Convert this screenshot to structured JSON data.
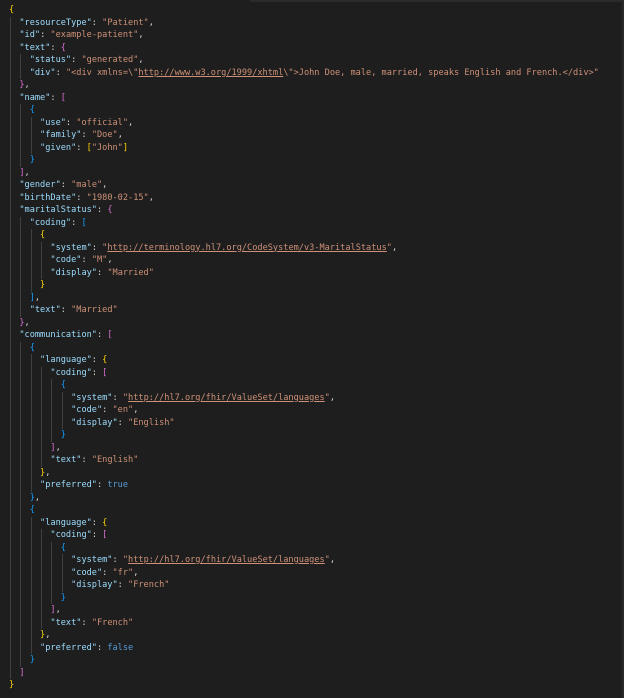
{
  "editor": {
    "language": "json",
    "theme_colors": {
      "background": "#1e1e1e",
      "key": "#9cdcfe",
      "string": "#ce9178",
      "keyword": "#569cd6",
      "punctuation": "#d4d4d4",
      "bracket_level_1": "#ffd700",
      "bracket_level_2": "#da70d6",
      "bracket_level_3": "#179fff"
    },
    "lines": [
      [
        [
          "{",
          "b0"
        ]
      ],
      [
        [
          "  ",
          ""
        ],
        [
          "\"resourceType\"",
          "k"
        ],
        [
          ": ",
          "p"
        ],
        [
          "\"Patient\"",
          "s"
        ],
        [
          ",",
          "p"
        ]
      ],
      [
        [
          "  ",
          ""
        ],
        [
          "\"id\"",
          "k"
        ],
        [
          ": ",
          "p"
        ],
        [
          "\"example-patient\"",
          "s"
        ],
        [
          ",",
          "p"
        ]
      ],
      [
        [
          "  ",
          ""
        ],
        [
          "\"text\"",
          "k"
        ],
        [
          ": ",
          "p"
        ],
        [
          "{",
          "b1"
        ]
      ],
      [
        [
          "    ",
          ""
        ],
        [
          "\"status\"",
          "k"
        ],
        [
          ": ",
          "p"
        ],
        [
          "\"generated\"",
          "s"
        ],
        [
          ",",
          "p"
        ]
      ],
      [
        [
          "    ",
          ""
        ],
        [
          "\"div\"",
          "k"
        ],
        [
          ": ",
          "p"
        ],
        [
          "\"<div xmlns=\\\"",
          "s"
        ],
        [
          "http://www.w3.org/1999/xhtml",
          "su"
        ],
        [
          "\\\">John Doe, male, married, speaks English and French.</div>\"",
          "s"
        ]
      ],
      [
        [
          "  ",
          ""
        ],
        [
          "}",
          "b1"
        ],
        [
          ",",
          "p"
        ]
      ],
      [
        [
          "  ",
          ""
        ],
        [
          "\"name\"",
          "k"
        ],
        [
          ": ",
          "p"
        ],
        [
          "[",
          "b1"
        ]
      ],
      [
        [
          "    ",
          ""
        ],
        [
          "{",
          "b2"
        ]
      ],
      [
        [
          "      ",
          ""
        ],
        [
          "\"use\"",
          "k"
        ],
        [
          ": ",
          "p"
        ],
        [
          "\"official\"",
          "s"
        ],
        [
          ",",
          "p"
        ]
      ],
      [
        [
          "      ",
          ""
        ],
        [
          "\"family\"",
          "k"
        ],
        [
          ": ",
          "p"
        ],
        [
          "\"Doe\"",
          "s"
        ],
        [
          ",",
          "p"
        ]
      ],
      [
        [
          "      ",
          ""
        ],
        [
          "\"given\"",
          "k"
        ],
        [
          ": ",
          "p"
        ],
        [
          "[",
          "b0"
        ],
        [
          "\"John\"",
          "s"
        ],
        [
          "]",
          "b0"
        ]
      ],
      [
        [
          "    ",
          ""
        ],
        [
          "}",
          "b2"
        ]
      ],
      [
        [
          "  ",
          ""
        ],
        [
          "]",
          "b1"
        ],
        [
          ",",
          "p"
        ]
      ],
      [
        [
          "  ",
          ""
        ],
        [
          "\"gender\"",
          "k"
        ],
        [
          ": ",
          "p"
        ],
        [
          "\"male\"",
          "s"
        ],
        [
          ",",
          "p"
        ]
      ],
      [
        [
          "  ",
          ""
        ],
        [
          "\"birthDate\"",
          "k"
        ],
        [
          ": ",
          "p"
        ],
        [
          "\"1980-02-15\"",
          "s"
        ],
        [
          ",",
          "p"
        ]
      ],
      [
        [
          "  ",
          ""
        ],
        [
          "\"maritalStatus\"",
          "k"
        ],
        [
          ": ",
          "p"
        ],
        [
          "{",
          "b1"
        ]
      ],
      [
        [
          "    ",
          ""
        ],
        [
          "\"coding\"",
          "k"
        ],
        [
          ": ",
          "p"
        ],
        [
          "[",
          "b2"
        ]
      ],
      [
        [
          "      ",
          ""
        ],
        [
          "{",
          "b0"
        ]
      ],
      [
        [
          "        ",
          ""
        ],
        [
          "\"system\"",
          "k"
        ],
        [
          ": ",
          "p"
        ],
        [
          "\"",
          "s"
        ],
        [
          "http://terminology.hl7.org/CodeSystem/v3-MaritalStatus",
          "su"
        ],
        [
          "\"",
          "s"
        ],
        [
          ",",
          "p"
        ]
      ],
      [
        [
          "        ",
          ""
        ],
        [
          "\"code\"",
          "k"
        ],
        [
          ": ",
          "p"
        ],
        [
          "\"M\"",
          "s"
        ],
        [
          ",",
          "p"
        ]
      ],
      [
        [
          "        ",
          ""
        ],
        [
          "\"display\"",
          "k"
        ],
        [
          ": ",
          "p"
        ],
        [
          "\"Married\"",
          "s"
        ]
      ],
      [
        [
          "      ",
          ""
        ],
        [
          "}",
          "b0"
        ]
      ],
      [
        [
          "    ",
          ""
        ],
        [
          "]",
          "b2"
        ],
        [
          ",",
          "p"
        ]
      ],
      [
        [
          "    ",
          ""
        ],
        [
          "\"text\"",
          "k"
        ],
        [
          ": ",
          "p"
        ],
        [
          "\"Married\"",
          "s"
        ]
      ],
      [
        [
          "  ",
          ""
        ],
        [
          "}",
          "b1"
        ],
        [
          ",",
          "p"
        ]
      ],
      [
        [
          "  ",
          ""
        ],
        [
          "\"communication\"",
          "k"
        ],
        [
          ": ",
          "p"
        ],
        [
          "[",
          "b1"
        ]
      ],
      [
        [
          "    ",
          ""
        ],
        [
          "{",
          "b2"
        ]
      ],
      [
        [
          "      ",
          ""
        ],
        [
          "\"language\"",
          "k"
        ],
        [
          ": ",
          "p"
        ],
        [
          "{",
          "b0"
        ]
      ],
      [
        [
          "        ",
          ""
        ],
        [
          "\"coding\"",
          "k"
        ],
        [
          ": ",
          "p"
        ],
        [
          "[",
          "b1"
        ]
      ],
      [
        [
          "          ",
          ""
        ],
        [
          "{",
          "b2"
        ]
      ],
      [
        [
          "            ",
          ""
        ],
        [
          "\"system\"",
          "k"
        ],
        [
          ": ",
          "p"
        ],
        [
          "\"",
          "s"
        ],
        [
          "http://hl7.org/fhir/ValueSet/languages",
          "su"
        ],
        [
          "\"",
          "s"
        ],
        [
          ",",
          "p"
        ]
      ],
      [
        [
          "            ",
          ""
        ],
        [
          "\"code\"",
          "k"
        ],
        [
          ": ",
          "p"
        ],
        [
          "\"en\"",
          "s"
        ],
        [
          ",",
          "p"
        ]
      ],
      [
        [
          "            ",
          ""
        ],
        [
          "\"display\"",
          "k"
        ],
        [
          ": ",
          "p"
        ],
        [
          "\"English\"",
          "s"
        ]
      ],
      [
        [
          "          ",
          ""
        ],
        [
          "}",
          "b2"
        ]
      ],
      [
        [
          "        ",
          ""
        ],
        [
          "]",
          "b1"
        ],
        [
          ",",
          "p"
        ]
      ],
      [
        [
          "        ",
          ""
        ],
        [
          "\"text\"",
          "k"
        ],
        [
          ": ",
          "p"
        ],
        [
          "\"English\"",
          "s"
        ]
      ],
      [
        [
          "      ",
          ""
        ],
        [
          "}",
          "b0"
        ],
        [
          ",",
          "p"
        ]
      ],
      [
        [
          "      ",
          ""
        ],
        [
          "\"preferred\"",
          "k"
        ],
        [
          ": ",
          "p"
        ],
        [
          "true",
          "v"
        ]
      ],
      [
        [
          "    ",
          ""
        ],
        [
          "}",
          "b2"
        ],
        [
          ",",
          "p"
        ]
      ],
      [
        [
          "    ",
          ""
        ],
        [
          "{",
          "b2"
        ]
      ],
      [
        [
          "      ",
          ""
        ],
        [
          "\"language\"",
          "k"
        ],
        [
          ": ",
          "p"
        ],
        [
          "{",
          "b0"
        ]
      ],
      [
        [
          "        ",
          ""
        ],
        [
          "\"coding\"",
          "k"
        ],
        [
          ": ",
          "p"
        ],
        [
          "[",
          "b1"
        ]
      ],
      [
        [
          "          ",
          ""
        ],
        [
          "{",
          "b2"
        ]
      ],
      [
        [
          "            ",
          ""
        ],
        [
          "\"system\"",
          "k"
        ],
        [
          ": ",
          "p"
        ],
        [
          "\"",
          "s"
        ],
        [
          "http://hl7.org/fhir/ValueSet/languages",
          "su"
        ],
        [
          "\"",
          "s"
        ],
        [
          ",",
          "p"
        ]
      ],
      [
        [
          "            ",
          ""
        ],
        [
          "\"code\"",
          "k"
        ],
        [
          ": ",
          "p"
        ],
        [
          "\"fr\"",
          "s"
        ],
        [
          ",",
          "p"
        ]
      ],
      [
        [
          "            ",
          ""
        ],
        [
          "\"display\"",
          "k"
        ],
        [
          ": ",
          "p"
        ],
        [
          "\"French\"",
          "s"
        ]
      ],
      [
        [
          "          ",
          ""
        ],
        [
          "}",
          "b2"
        ]
      ],
      [
        [
          "        ",
          ""
        ],
        [
          "]",
          "b1"
        ],
        [
          ",",
          "p"
        ]
      ],
      [
        [
          "        ",
          ""
        ],
        [
          "\"text\"",
          "k"
        ],
        [
          ": ",
          "p"
        ],
        [
          "\"French\"",
          "s"
        ]
      ],
      [
        [
          "      ",
          ""
        ],
        [
          "}",
          "b0"
        ],
        [
          ",",
          "p"
        ]
      ],
      [
        [
          "      ",
          ""
        ],
        [
          "\"preferred\"",
          "k"
        ],
        [
          ": ",
          "p"
        ],
        [
          "false",
          "v"
        ]
      ],
      [
        [
          "    ",
          ""
        ],
        [
          "}",
          "b2"
        ]
      ],
      [
        [
          "  ",
          ""
        ],
        [
          "]",
          "b1"
        ]
      ],
      [
        [
          "}",
          "b0"
        ]
      ]
    ]
  }
}
